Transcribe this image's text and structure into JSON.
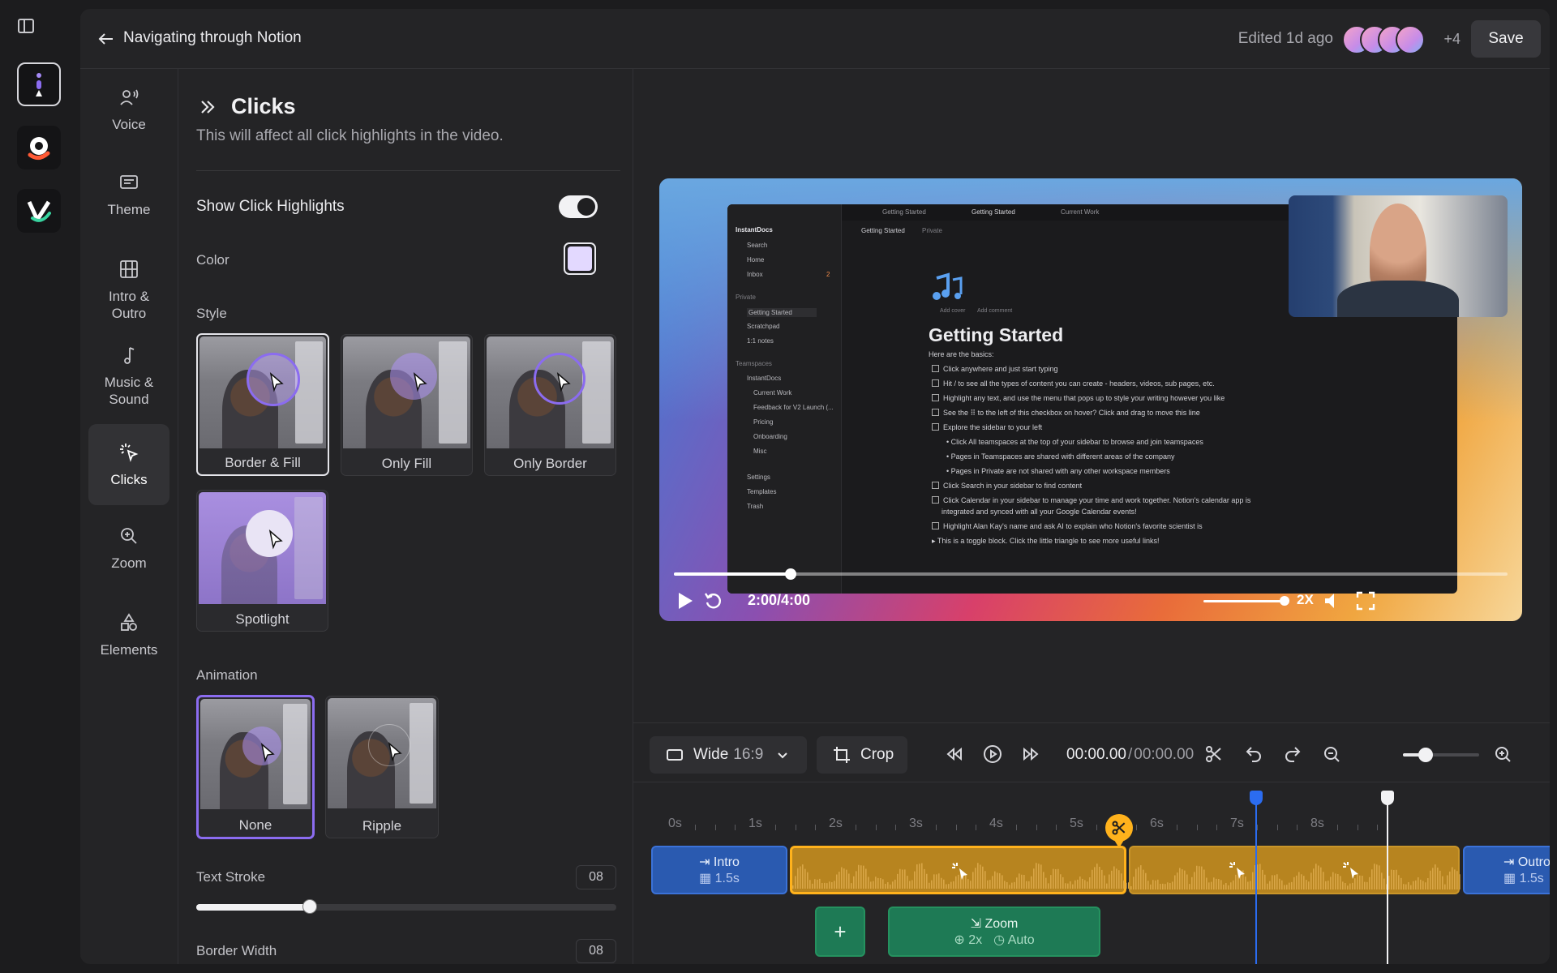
{
  "header": {
    "project_title": "Navigating through Notion",
    "edited": "Edited 1d ago",
    "collaborators_extra": "+4",
    "save_label": "Save"
  },
  "nav": {
    "voice": "Voice",
    "theme": "Theme",
    "intro_outro": "Intro & Outro",
    "music_sound": "Music & Sound",
    "clicks": "Clicks",
    "zoom": "Zoom",
    "elements": "Elements"
  },
  "panel": {
    "title": "Clicks",
    "description": "This will affect all click highlights in the video.",
    "show_highlights_label": "Show Click Highlights",
    "show_highlights_on": true,
    "color_label": "Color",
    "color_value": "#e3d9ff",
    "style_label": "Style",
    "styles": [
      "Border & Fill",
      "Only Fill",
      "Only Border",
      "Spotlight"
    ],
    "selected_style": "Border & Fill",
    "animation_label": "Animation",
    "animations": [
      "None",
      "Ripple"
    ],
    "selected_animation": "None",
    "text_stroke_label": "Text Stroke",
    "text_stroke_value": "08",
    "text_stroke_level": 0.27,
    "border_width_label": "Border Width",
    "border_width_value": "08"
  },
  "preview": {
    "notion": {
      "workspace": "InstantDocs",
      "sidebar_top": [
        "Search",
        "Home",
        "Inbox"
      ],
      "inbox_badge": "2",
      "private_header": "Private",
      "private_items": [
        "Getting Started",
        "Scratchpad",
        "1:1 notes"
      ],
      "teamspaces_header": "Teamspaces",
      "teamspace_items": [
        "InstantDocs",
        "Current Work",
        "Feedback for V2 Launch (...",
        "Pricing",
        "Onboarding",
        "Misc"
      ],
      "bottom_items": [
        "Settings",
        "Templates",
        "Trash"
      ],
      "tabs": [
        "Getting Started",
        "Getting Started",
        "Current Work"
      ],
      "breadcrumb": "Getting Started",
      "breadcrumb_tag": "Private",
      "page_meta": [
        "Add cover",
        "Add comment"
      ],
      "page_title": "Getting Started",
      "intro": "Here are the basics:",
      "lines": [
        "Click anywhere and just start typing",
        "Hit / to see all the types of content you can create - headers, videos, sub pages, etc.",
        "Highlight any text, and use the menu that pops up to style your writing however you like",
        "See the ⠿ to the left of this checkbox on hover? Click and drag to move this line",
        "Explore the sidebar to your left",
        "Click All teamspaces at the top of your sidebar to browse and join teamspaces",
        "Pages in Teamspaces are shared with different areas of the company",
        "Pages in Private are not shared with any other workspace members",
        "Click Search in your sidebar to find content",
        "Click Calendar in your sidebar to manage your time and work together. Notion's calendar app is",
        "integrated and synced with all your Google Calendar events!",
        "Highlight Alan Kay's name and ask AI to explain who Notion's favorite scientist is",
        "This is a toggle block. Click the little triangle to see more useful links!"
      ]
    },
    "time": "2:00/4:00",
    "progress": 0.14,
    "speed": "2X",
    "volume": 1.0
  },
  "toolbar": {
    "aspect_label": "Wide",
    "aspect_ratio": "16:9",
    "crop_label": "Crop",
    "timecode_current": "00:00.00",
    "timecode_sep": "/",
    "timecode_total": "00:00.00",
    "zoom_level": 0.3
  },
  "timeline": {
    "ticks": [
      "0s",
      "1s",
      "2s",
      "3s",
      "4s",
      "5s",
      "6s",
      "7s",
      "8s"
    ],
    "intro_label": "Intro",
    "intro_duration": "1.5s",
    "outro_label": "Outro",
    "outro_duration": "1.5s",
    "add_label": "+",
    "zoom_clip_label": "Zoom",
    "zoom_clip_scale": "2x",
    "zoom_clip_mode": "Auto"
  },
  "colors": {
    "accent_purple": "#8b6cf0",
    "clip_gold": "#ffb21c",
    "clip_blue": "#2a5ab0",
    "clip_green": "#1e7a55",
    "playhead_blue": "#2b6cf0"
  }
}
